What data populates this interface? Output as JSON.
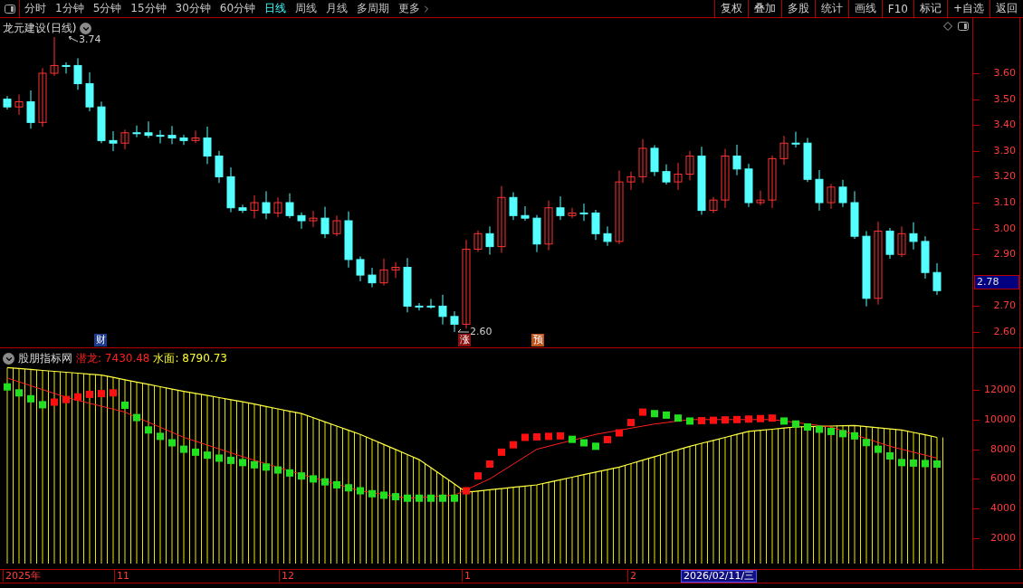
{
  "toolbar": {
    "periods": [
      {
        "label": "分时",
        "selected": false
      },
      {
        "label": "1分钟",
        "selected": false
      },
      {
        "label": "5分钟",
        "selected": false
      },
      {
        "label": "15分钟",
        "selected": false
      },
      {
        "label": "30分钟",
        "selected": false
      },
      {
        "label": "60分钟",
        "selected": false
      },
      {
        "label": "日线",
        "selected": true
      },
      {
        "label": "周线",
        "selected": false
      },
      {
        "label": "月线",
        "selected": false
      },
      {
        "label": "多周期",
        "selected": false
      },
      {
        "label": "更多",
        "selected": false
      }
    ],
    "actions": [
      "复权",
      "叠加",
      "多股",
      "统计",
      "画线",
      "F10",
      "标记",
      "+自选",
      "返回"
    ]
  },
  "main_chart": {
    "title": "龙元建设(日线)",
    "high_label": "3.74",
    "low_label": "2.60",
    "y_ticks": [
      "3.60",
      "3.50",
      "3.40",
      "3.30",
      "3.20",
      "3.10",
      "3.00",
      "2.90",
      "2.70",
      "2.60"
    ],
    "current_price": "2.78",
    "event_markers": [
      {
        "label": "财",
        "color": "#1b3a8a"
      },
      {
        "label": "涨",
        "color": "#8a1010"
      },
      {
        "label": "预",
        "color": "#c0521a"
      }
    ]
  },
  "indicator": {
    "name": "股朋指标网",
    "values": [
      {
        "text": "潜龙: 7430.48",
        "color": "#ff2020"
      },
      {
        "text": "水面: 8790.73",
        "color": "#ffff30"
      }
    ],
    "y_ticks": [
      "12000",
      "10000",
      "8000",
      "6000",
      "4000",
      "2000"
    ]
  },
  "date_axis": {
    "labels": [
      "2025年",
      "11",
      "12",
      "1",
      "2"
    ],
    "cursor_date": "2026/02/11/三"
  }
}
